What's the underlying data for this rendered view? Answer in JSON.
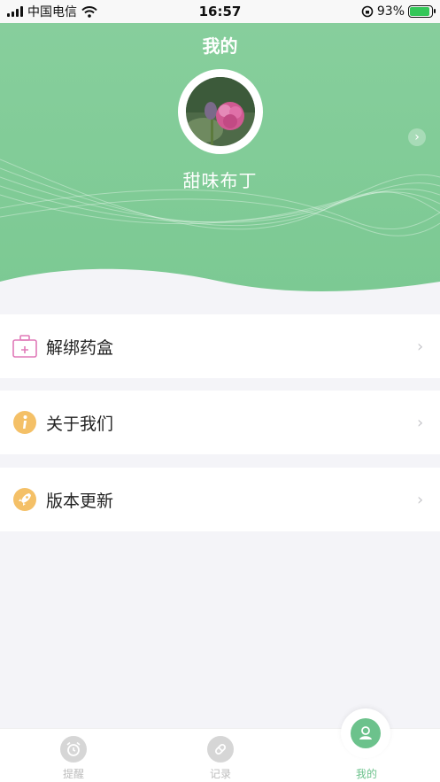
{
  "status_bar": {
    "carrier": "中国电信",
    "time": "16:57",
    "battery_percent": "93%",
    "battery_level": 0.93
  },
  "header": {
    "title": "我的",
    "username": "甜味布丁",
    "accent_color": "#7dca95"
  },
  "menu": {
    "items": [
      {
        "label": "解绑药盒",
        "icon": "medicine-box-icon"
      },
      {
        "label": "关于我们",
        "icon": "info-icon"
      },
      {
        "label": "版本更新",
        "icon": "rocket-icon"
      }
    ]
  },
  "tabbar": {
    "tabs": [
      {
        "label": "提醒",
        "icon": "alarm-clock-icon"
      },
      {
        "label": "记录",
        "icon": "pill-icon"
      },
      {
        "label": "我的",
        "icon": "user-icon"
      }
    ],
    "active_color": "#6cc28c"
  }
}
